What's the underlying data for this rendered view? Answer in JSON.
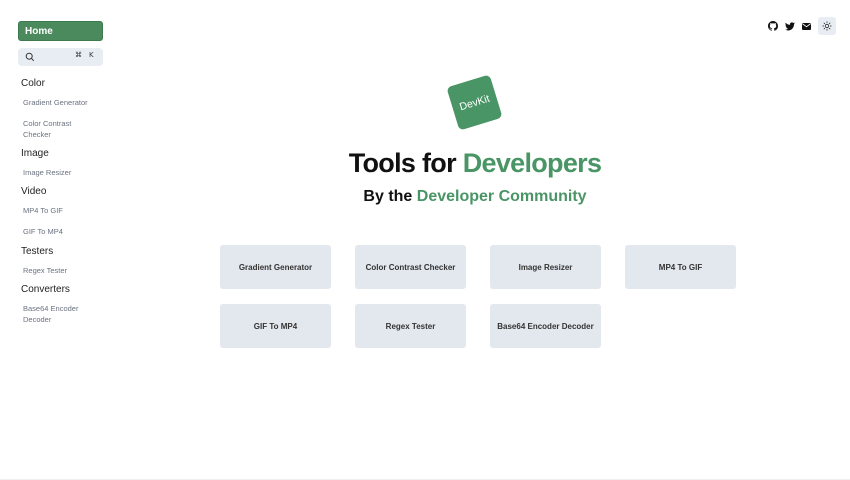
{
  "sidebar": {
    "home_label": "Home",
    "search_shortcut_cmd": "⌘",
    "search_shortcut_key": "K",
    "groups": [
      {
        "title": "Color",
        "items": [
          "Gradient Generator",
          "Color Contrast Checker"
        ]
      },
      {
        "title": "Image",
        "items": [
          "Image Resizer"
        ]
      },
      {
        "title": "Video",
        "items": [
          "MP4 To GIF",
          "GIF To MP4"
        ]
      },
      {
        "title": "Testers",
        "items": [
          "Regex Tester"
        ]
      },
      {
        "title": "Converters",
        "items": [
          "Base64 Encoder Decoder"
        ]
      }
    ]
  },
  "header_icons": [
    "github-icon",
    "twitter-icon",
    "mail-icon",
    "sun-icon"
  ],
  "hero": {
    "logo_text": "DevKit",
    "title_plain": "Tools for ",
    "title_accent": "Developers",
    "subtitle_plain": "By the ",
    "subtitle_accent": "Developer Community"
  },
  "tool_cards": [
    "Gradient Generator",
    "Color Contrast Checker",
    "Image Resizer",
    "MP4 To GIF",
    "GIF To MP4",
    "Regex Tester",
    "Base64 Encoder Decoder"
  ],
  "colors": {
    "accent": "#4a9565",
    "home_button": "#4a8a5c",
    "card_background": "#e3e8ef",
    "search_background": "#e8edf3"
  }
}
